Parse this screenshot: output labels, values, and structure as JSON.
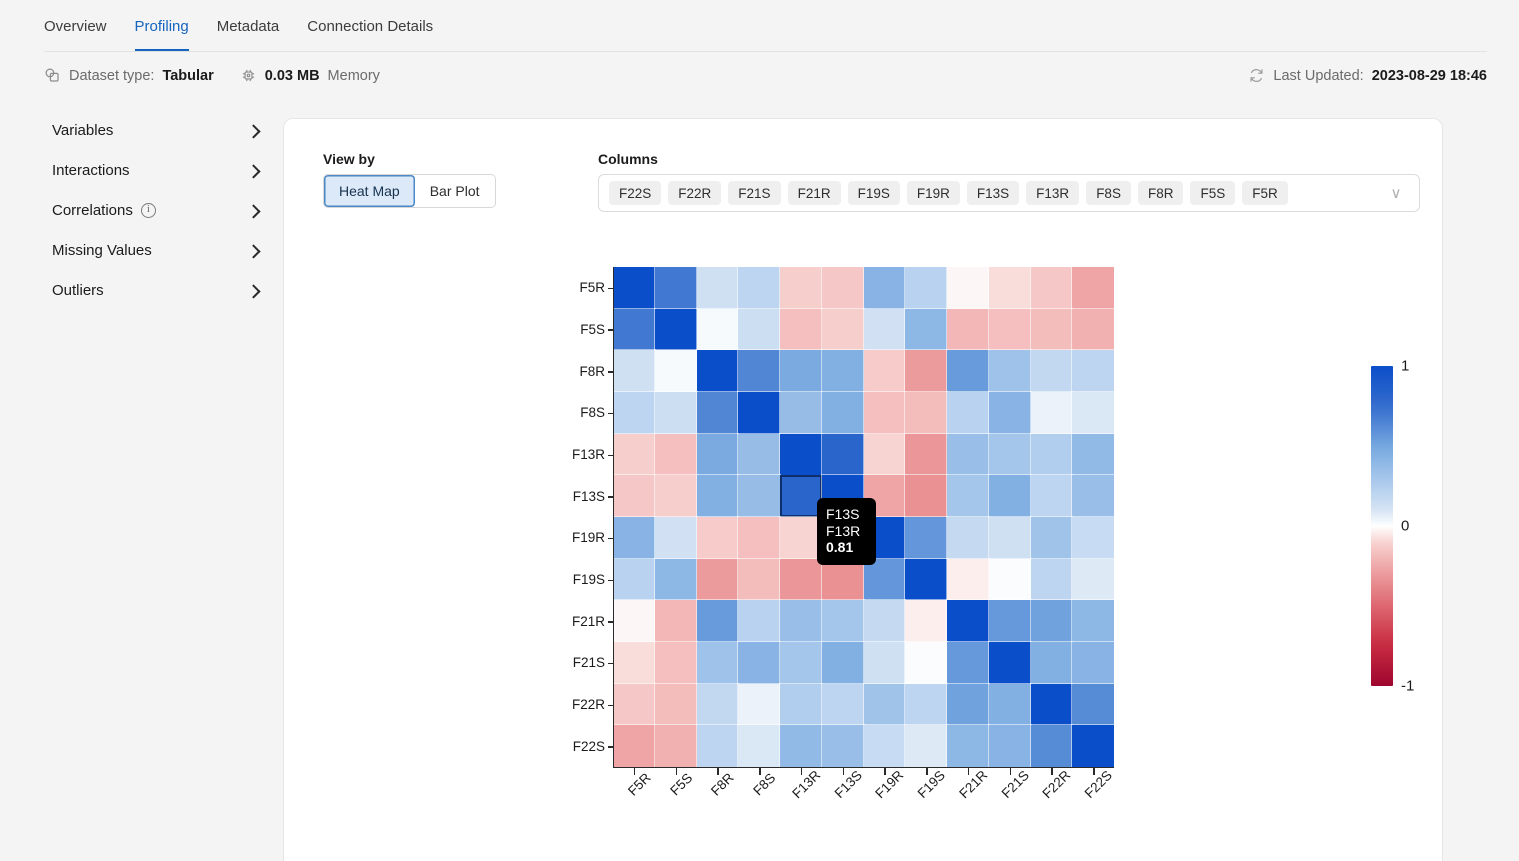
{
  "tabs": [
    {
      "label": "Overview",
      "active": false
    },
    {
      "label": "Profiling",
      "active": true
    },
    {
      "label": "Metadata",
      "active": false
    },
    {
      "label": "Connection Details",
      "active": false
    }
  ],
  "meta": {
    "dataset_type_label": "Dataset type:",
    "dataset_type_value": "Tabular",
    "dataset_type_icon": "copy-icon",
    "memory_value": "0.03 MB",
    "memory_label": "Memory",
    "memory_icon": "cpu-icon",
    "last_updated_label": "Last Updated:",
    "last_updated_value": "2023-08-29 18:46",
    "refresh_icon": "refresh-icon"
  },
  "sidebar": {
    "items": [
      {
        "label": "Variables",
        "icon": "chevron-right-icon",
        "info": false
      },
      {
        "label": "Interactions",
        "icon": "chevron-right-icon",
        "info": false
      },
      {
        "label": "Correlations",
        "icon": "chevron-right-icon",
        "info": true,
        "info_icon": "info-icon",
        "info_glyph": "i"
      },
      {
        "label": "Missing Values",
        "icon": "chevron-right-icon",
        "info": false
      },
      {
        "label": "Outliers",
        "icon": "chevron-right-icon",
        "info": false
      }
    ]
  },
  "controls": {
    "view_by_label": "View by",
    "view_by_options": [
      {
        "label": "Heat Map",
        "active": true
      },
      {
        "label": "Bar Plot",
        "active": false
      }
    ],
    "columns_label": "Columns",
    "columns_chips": [
      "F22S",
      "F22R",
      "F21S",
      "F21R",
      "F19S",
      "F19R",
      "F13S",
      "F13R",
      "F8S",
      "F8R",
      "F5S",
      "F5R"
    ],
    "columns_caret_icon": "chevron-down-icon",
    "columns_caret_glyph": "∨"
  },
  "tooltip": {
    "row": "F13S",
    "column": "F13R",
    "value": "0.81"
  },
  "colorbar": {
    "max_label": "1",
    "mid_label": "0",
    "min_label": "-1",
    "high_color": "#0b4ec9",
    "mid_color": "#ffffff",
    "low_color": "#c70a37"
  },
  "chart_data": {
    "type": "heatmap",
    "title": "",
    "xlabel": "",
    "ylabel": "",
    "colormap": "RdBu reversed (blue = +1, white = 0, crimson = -1)",
    "zlim": [
      -1,
      1
    ],
    "legend_position": "right",
    "grid": false,
    "x": [
      "F5R",
      "F5S",
      "F8R",
      "F8S",
      "F13R",
      "F13S",
      "F19R",
      "F19S",
      "F21R",
      "F21S",
      "F22R",
      "F22S"
    ],
    "y": [
      "F5R",
      "F5S",
      "F8R",
      "F8S",
      "F13R",
      "F13S",
      "F19R",
      "F19S",
      "F21R",
      "F21S",
      "F22R",
      "F22S"
    ],
    "selected_cell": {
      "row": "F13S",
      "column": "F13R",
      "value": 0.81
    },
    "values": [
      [
        1.0,
        0.7,
        0.13,
        0.2,
        -0.12,
        -0.14,
        0.42,
        0.22,
        -0.02,
        -0.08,
        -0.14,
        -0.26
      ],
      [
        0.7,
        1.0,
        0.02,
        0.14,
        -0.17,
        -0.12,
        0.12,
        0.4,
        -0.2,
        -0.17,
        -0.18,
        -0.22
      ],
      [
        0.13,
        0.02,
        1.0,
        0.64,
        0.48,
        0.44,
        -0.13,
        -0.3,
        0.55,
        0.33,
        0.18,
        0.2
      ],
      [
        0.2,
        0.14,
        0.64,
        1.0,
        0.36,
        0.44,
        -0.17,
        -0.18,
        0.22,
        0.42,
        0.05,
        0.09
      ],
      [
        -0.12,
        -0.17,
        0.48,
        0.36,
        1.0,
        0.81,
        -0.1,
        -0.32,
        0.35,
        0.3,
        0.25,
        0.38
      ],
      [
        -0.14,
        -0.12,
        0.44,
        0.36,
        0.81,
        1.0,
        -0.26,
        -0.34,
        0.3,
        0.44,
        0.2,
        0.35
      ],
      [
        0.42,
        0.12,
        -0.13,
        -0.17,
        -0.1,
        -0.26,
        1.0,
        0.57,
        0.17,
        0.13,
        0.32,
        0.16
      ],
      [
        0.22,
        0.4,
        -0.3,
        -0.18,
        -0.32,
        -0.34,
        0.57,
        1.0,
        -0.04,
        0.01,
        0.2,
        0.08
      ],
      [
        -0.02,
        -0.2,
        0.55,
        0.22,
        0.35,
        0.3,
        0.17,
        -0.04,
        1.0,
        0.56,
        0.52,
        0.4
      ],
      [
        -0.08,
        -0.17,
        0.33,
        0.42,
        0.3,
        0.44,
        0.13,
        0.01,
        0.56,
        1.0,
        0.44,
        0.42
      ],
      [
        -0.14,
        -0.18,
        0.18,
        0.05,
        0.25,
        0.2,
        0.32,
        0.2,
        0.52,
        0.44,
        1.0,
        0.62
      ],
      [
        -0.26,
        -0.22,
        0.2,
        0.09,
        0.38,
        0.35,
        0.16,
        0.08,
        0.4,
        0.42,
        0.62,
        1.0
      ]
    ]
  }
}
